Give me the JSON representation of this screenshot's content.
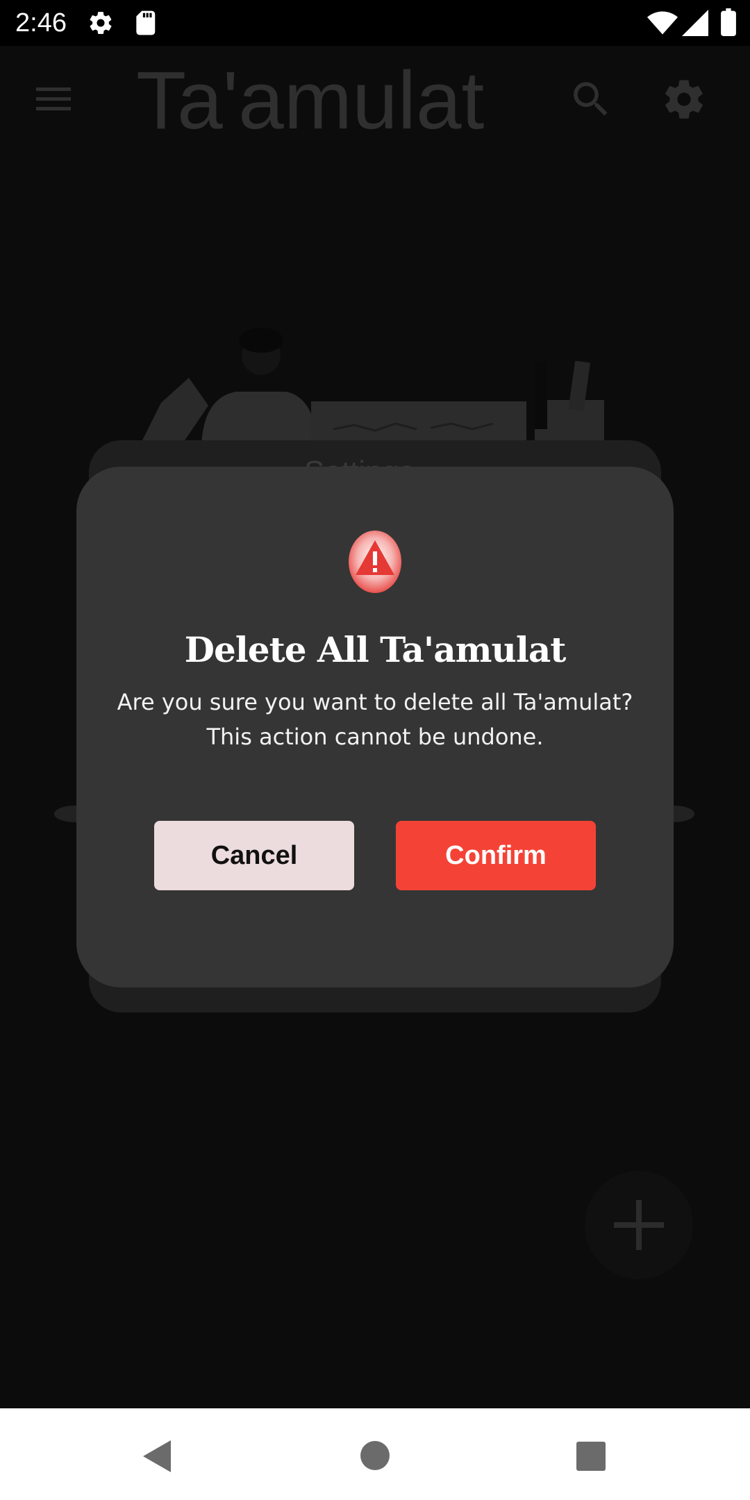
{
  "status_bar": {
    "time": "2:46",
    "icons": [
      "gear-icon",
      "sd-card-icon",
      "wifi-icon",
      "signal-icon",
      "battery-icon"
    ]
  },
  "app_bar": {
    "title": "Ta'amulat",
    "icons": [
      "menu-icon",
      "search-icon",
      "settings-icon"
    ]
  },
  "background": {
    "card_peek_text": "Settings"
  },
  "dialog": {
    "icon": "warning-icon",
    "title": "Delete All Ta'amulat",
    "message_line1": "Are you sure you want to delete all Ta'amulat?",
    "message_line2": "This action cannot be undone.",
    "cancel_label": "Cancel",
    "confirm_label": "Confirm"
  },
  "fab": {
    "icon": "plus-icon"
  },
  "nav_bar": {
    "icons": [
      "back-icon",
      "home-icon",
      "recents-icon"
    ]
  },
  "colors": {
    "scrim_background": "#0c0c0c",
    "dialog_background": "#353535",
    "confirm_button": "#f44336",
    "cancel_button": "#eddcdd",
    "warning_red": "#e53935"
  }
}
